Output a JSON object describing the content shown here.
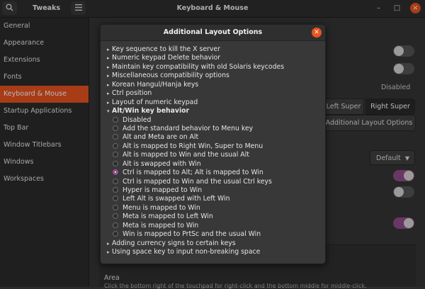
{
  "header": {
    "app_title": "Tweaks",
    "window_title": "Keyboard & Mouse",
    "search_icon": "search-icon",
    "menu_icon": "hamburger-menu-icon",
    "minimize": "–",
    "maximize": "□",
    "close": "×"
  },
  "sidebar": {
    "items": [
      {
        "label": "General"
      },
      {
        "label": "Appearance"
      },
      {
        "label": "Extensions"
      },
      {
        "label": "Fonts"
      },
      {
        "label": "Keyboard & Mouse",
        "active": true
      },
      {
        "label": "Startup Applications"
      },
      {
        "label": "Top Bar"
      },
      {
        "label": "Window Titlebars"
      },
      {
        "label": "Windows"
      },
      {
        "label": "Workspaces"
      }
    ]
  },
  "main": {
    "disabled_label": "Disabled",
    "overview_key": {
      "left": "Left Super",
      "right": "Right Super",
      "selected": "Right Super"
    },
    "additional_layout_button": "Additional Layout Options",
    "dropdown_value": "Default",
    "area_label": "Area",
    "area_desc": "Click the bottom right of the touchpad for right-click and the bottom middle for middle-click.",
    "toggles": [
      {
        "state": "off"
      },
      {
        "state": "off"
      },
      {
        "state": "on"
      },
      {
        "state": "off"
      },
      {
        "state": "on"
      }
    ]
  },
  "dialog": {
    "title": "Additional Layout Options",
    "groups_before": [
      {
        "label": "Key sequence to kill the X server",
        "arrow": "▸"
      },
      {
        "label": "Numeric keypad Delete behavior",
        "arrow": "▸"
      },
      {
        "label": "Maintain key compatibility with old Solaris keycodes",
        "arrow": "▸"
      },
      {
        "label": "Miscellaneous compatibility options",
        "arrow": "▸"
      },
      {
        "label": "Korean Hangul/Hanja keys",
        "arrow": "▸"
      },
      {
        "label": "Ctrl position",
        "arrow": "▸"
      },
      {
        "label": "Layout of numeric keypad",
        "arrow": "▸"
      }
    ],
    "expanded_group": {
      "label": "Alt/Win key behavior",
      "arrow": "▾"
    },
    "options": [
      {
        "label": "Disabled",
        "checked": false
      },
      {
        "label": "Add the standard behavior to Menu key",
        "checked": false
      },
      {
        "label": "Alt and Meta are on Alt",
        "checked": false
      },
      {
        "label": "Alt is mapped to Right Win, Super to Menu",
        "checked": false
      },
      {
        "label": "Alt is mapped to Win and the usual Alt",
        "checked": false
      },
      {
        "label": "Alt is swapped with Win",
        "checked": false
      },
      {
        "label": "Ctrl is mapped to Alt; Alt is mapped to Win",
        "checked": true
      },
      {
        "label": "Ctrl is mapped to Win and the usual Ctrl keys",
        "checked": false
      },
      {
        "label": "Hyper is mapped to Win",
        "checked": false
      },
      {
        "label": "Left Alt is swapped with Left Win",
        "checked": false
      },
      {
        "label": "Menu is mapped to Win",
        "checked": false
      },
      {
        "label": "Meta is mapped to Left Win",
        "checked": false
      },
      {
        "label": "Meta is mapped to Win",
        "checked": false
      },
      {
        "label": "Win is mapped to PrtSc and the usual Win",
        "checked": false
      }
    ],
    "groups_after": [
      {
        "label": "Adding currency signs to certain keys",
        "arrow": "▸"
      },
      {
        "label": "Using space key to input non-breaking space",
        "arrow": "▸"
      }
    ]
  },
  "colors": {
    "accent": "#e95420",
    "toggle_on": "#924d8b"
  }
}
